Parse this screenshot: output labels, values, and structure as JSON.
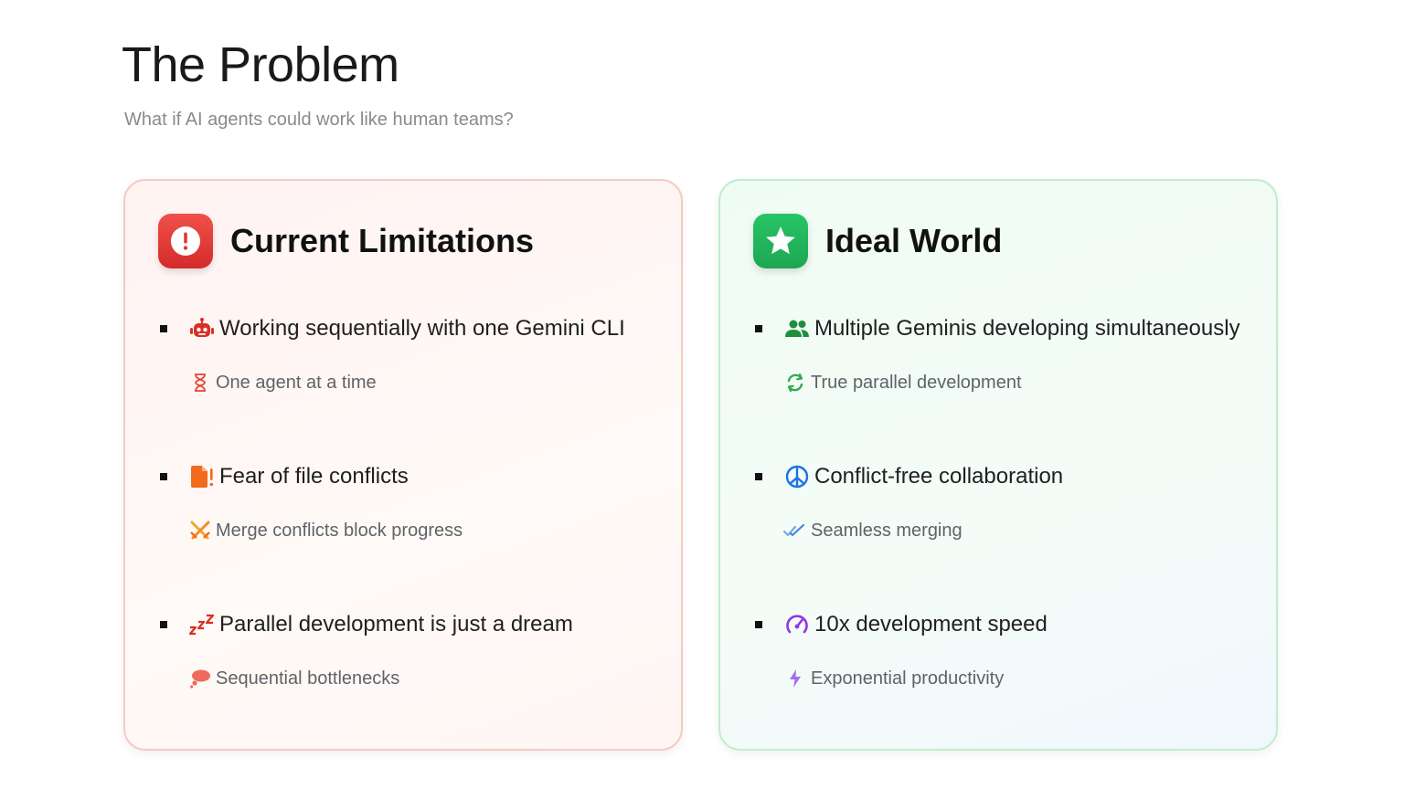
{
  "header": {
    "title": "The Problem",
    "subtitle": "What if AI agents could work like human teams?"
  },
  "cards": [
    {
      "title": "Current Limitations",
      "icon": "alert-icon",
      "accent": "#e03a36",
      "items": [
        {
          "text": "Working sequentially with one Gemini CLI",
          "icon": "robot-icon",
          "sub": "One agent at a time",
          "sub_icon": "hourglass-icon"
        },
        {
          "text": "Fear of file conflicts",
          "icon": "file-alert-icon",
          "sub": "Merge conflicts block progress",
          "sub_icon": "crossed-swords-icon"
        },
        {
          "text": "Parallel development is just a dream",
          "icon": "sleep-zzz-icon",
          "sub": "Sequential bottlenecks",
          "sub_icon": "thought-cloud-icon"
        }
      ]
    },
    {
      "title": "Ideal World",
      "icon": "star-icon",
      "accent": "#22b35c",
      "items": [
        {
          "text": "Multiple Geminis developing simultaneously",
          "icon": "users-icon",
          "sub": "True parallel development",
          "sub_icon": "sync-icon"
        },
        {
          "text": "Conflict-free collaboration",
          "icon": "peace-icon",
          "sub": "Seamless merging",
          "sub_icon": "double-check-icon"
        },
        {
          "text": "10x development speed",
          "icon": "speedometer-icon",
          "sub": "Exponential productivity",
          "sub_icon": "lightning-icon"
        }
      ]
    }
  ]
}
